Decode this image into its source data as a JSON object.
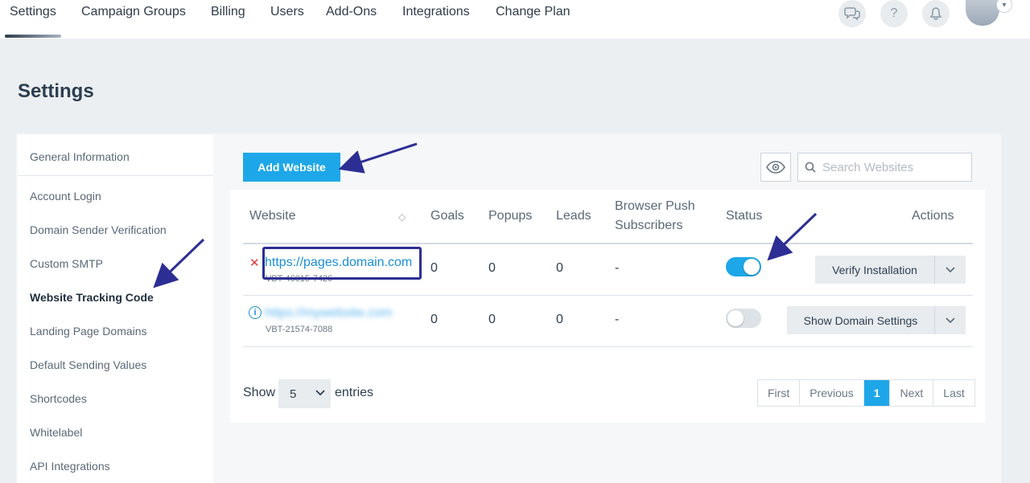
{
  "nav": {
    "items": [
      "Settings",
      "Campaign Groups",
      "Billing",
      "Users",
      "Add-Ons",
      "Integrations",
      "Change Plan"
    ],
    "icons": [
      "chat-icon",
      "help-icon",
      "bell-icon"
    ]
  },
  "page": {
    "title": "Settings"
  },
  "sidebar": {
    "items": [
      "General Information",
      "Account Login",
      "Domain Sender Verification",
      "Custom SMTP",
      "Website Tracking Code",
      "Landing Page Domains",
      "Default Sending Values",
      "Shortcodes",
      "Whitelabel",
      "API Integrations"
    ],
    "active_index": 4
  },
  "toolbar": {
    "add_label": "Add Website",
    "search_placeholder": "Search Websites"
  },
  "table": {
    "headers": {
      "website": "Website",
      "goals": "Goals",
      "popups": "Popups",
      "leads": "Leads",
      "push_line1": "Browser Push",
      "push_line2": "Subscribers",
      "status": "Status",
      "actions": "Actions"
    },
    "rows": [
      {
        "url": "https://pages.domain.com",
        "code": "VBT-46015-7426",
        "goals": "0",
        "popups": "0",
        "leads": "0",
        "push": "-",
        "status_on": true,
        "action": "Verify Installation",
        "indicator": "✕"
      },
      {
        "url": "https://mywebsite.com",
        "code": "VBT-21574-7088",
        "goals": "0",
        "popups": "0",
        "leads": "0",
        "push": "-",
        "status_on": false,
        "action": "Show Domain Settings",
        "indicator": "i"
      }
    ]
  },
  "footer": {
    "show_label": "Show",
    "entries_value": "5",
    "entries_label": "entries",
    "pagination": [
      "First",
      "Previous",
      "1",
      "Next",
      "Last"
    ],
    "current_page": "1"
  },
  "colors": {
    "accent": "#1ea7e8",
    "highlight": "#2d2e94",
    "error": "#e03b3b"
  }
}
